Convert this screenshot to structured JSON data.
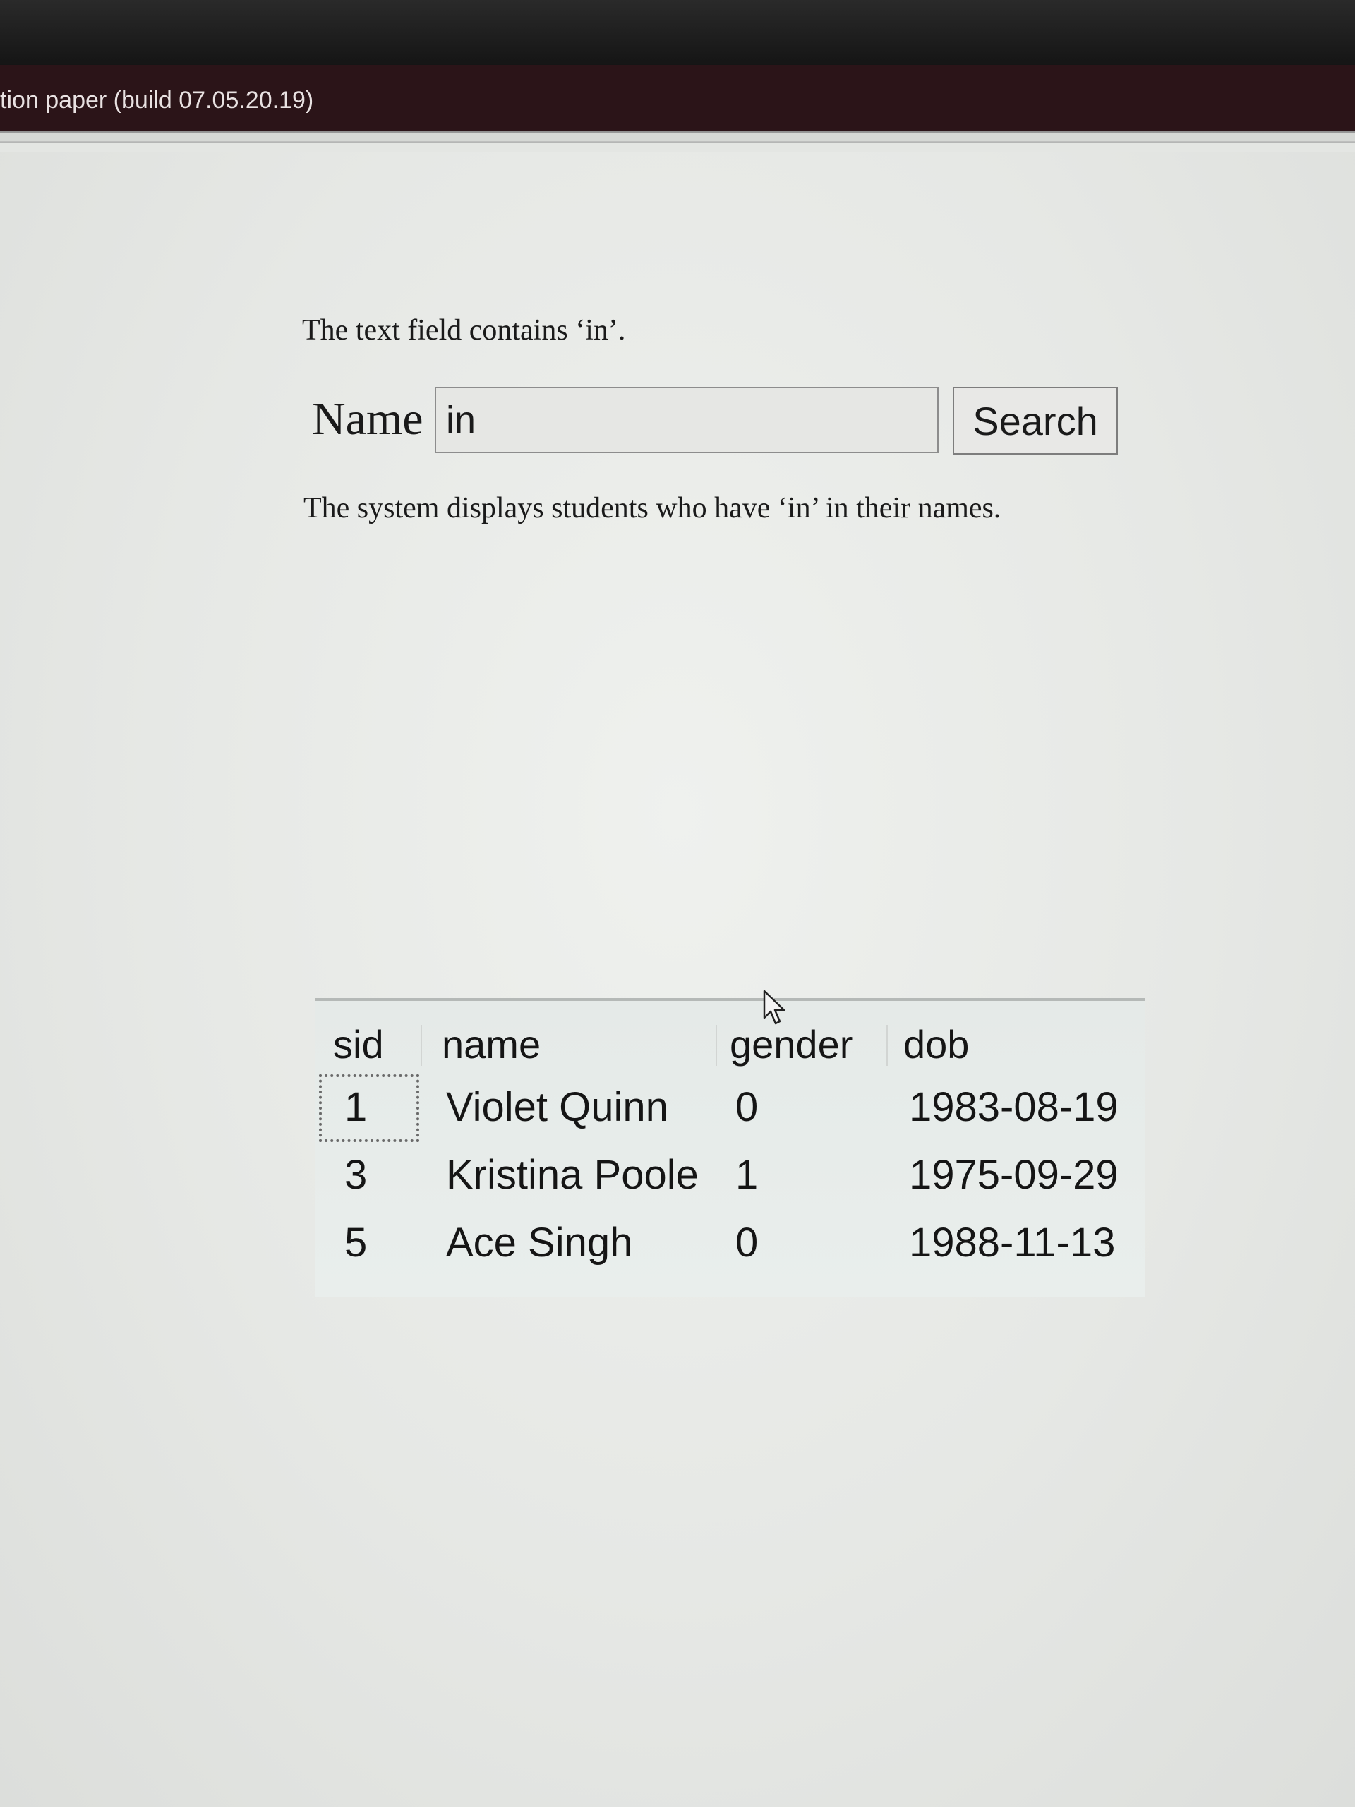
{
  "window": {
    "title": "tion paper (build 07.05.20.19)"
  },
  "form": {
    "intro_text": "The text field contains ‘in’.",
    "name_label": "Name",
    "name_value": "in",
    "search_label": "Search",
    "result_text": "The system displays students who have ‘in’ in their names."
  },
  "table": {
    "columns": [
      "sid",
      "name",
      "gender",
      "dob"
    ],
    "rows": [
      {
        "sid": "1",
        "name": "Violet Quinn",
        "gender": "0",
        "dob": "1983-08-19"
      },
      {
        "sid": "3",
        "name": "Kristina Poole",
        "gender": "1",
        "dob": "1975-09-29"
      },
      {
        "sid": "5",
        "name": "Ace Singh",
        "gender": "0",
        "dob": "1988-11-13"
      }
    ],
    "focused_row": 0
  },
  "colors": {
    "title_bar": "#2b1418",
    "background": "#e4e6e3",
    "grid_background": "#e7ecea"
  },
  "icons": {
    "pointer": "mouse-pointer-icon"
  }
}
